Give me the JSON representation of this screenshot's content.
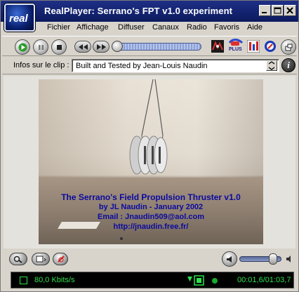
{
  "window": {
    "app_logo_text": "real",
    "title": "RealPlayer: Serrano's FPT v1.0 experiment"
  },
  "menu": {
    "items": [
      {
        "label": "Fichier"
      },
      {
        "label": "Affichage"
      },
      {
        "label": "Diffuser"
      },
      {
        "label": "Canaux"
      },
      {
        "label": "Radio"
      },
      {
        "label": "Favoris"
      },
      {
        "label": "Aide"
      }
    ]
  },
  "toolbar": {
    "plus_label": "PLUS",
    "seek_position_fraction": 0.0
  },
  "clip_info": {
    "label": "Infos sur le clip :",
    "value": "Built and Tested by Jean-Louis Naudin",
    "info_glyph": "i"
  },
  "video": {
    "overlay_lines": [
      "The Serrano's Field Propulsion Thruster v1.0",
      "by JL Naudin - January 2002",
      "Email : Jnaudin509@aol.com",
      "http://jnaudin.free.fr/"
    ]
  },
  "volume": {
    "level_fraction": 0.8
  },
  "status": {
    "bitrate": "80,0 Kbits/s",
    "time": "00:01,6/01:03,7",
    "accent_color": "#2ee04a"
  }
}
